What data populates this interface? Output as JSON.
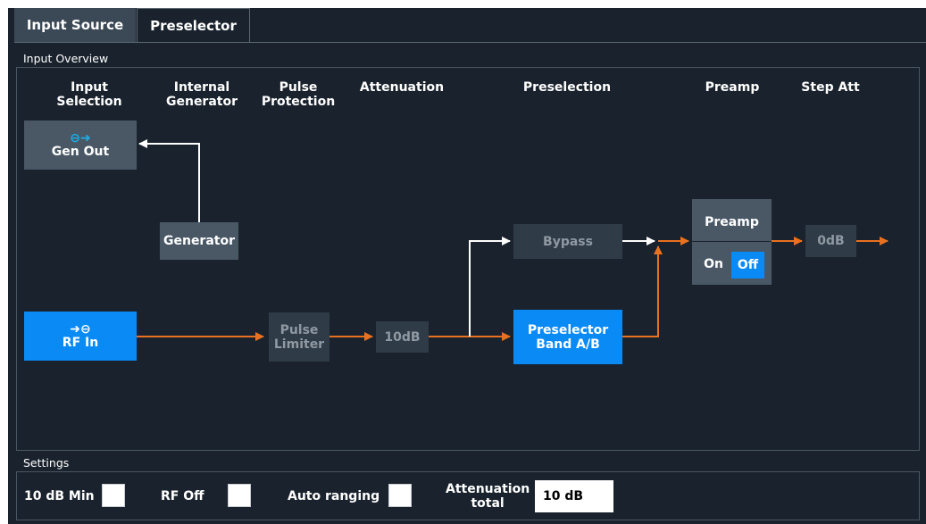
{
  "tabs": [
    {
      "label": "Input Source",
      "active": false
    },
    {
      "label": "Preselector",
      "active": true
    }
  ],
  "overview": {
    "group_label": "Input Overview",
    "headers": {
      "input_selection_1": "Input",
      "input_selection_2": "Selection",
      "internal_generator_1": "Internal",
      "internal_generator_2": "Generator",
      "pulse_protection_1": "Pulse",
      "pulse_protection_2": "Protection",
      "attenuation": "Attenuation",
      "preselection": "Preselection",
      "preamp": "Preamp",
      "step_att": "Step Att"
    },
    "blocks": {
      "gen_out": "Gen Out",
      "generator": "Generator",
      "rf_in": "RF In",
      "pulse_limiter_1": "Pulse",
      "pulse_limiter_2": "Limiter",
      "attenuation_value": "10dB",
      "bypass": "Bypass",
      "preselector_band_1": "Preselector",
      "preselector_band_2": "Band A/B",
      "preamp_title": "Preamp",
      "preamp_on": "On",
      "preamp_off": "Off",
      "step_att_value": "0dB"
    },
    "icons": {
      "gen_out": "output-arrow-icon",
      "rf_in": "input-arrow-icon"
    },
    "colors": {
      "signal_path": "#e8711f",
      "inactive_path": "#ffffff",
      "active_block": "#0a8af5"
    }
  },
  "settings": {
    "group_label": "Settings",
    "min_10db_label": "10 dB Min",
    "min_10db_checked": false,
    "rf_off_label": "RF Off",
    "rf_off_checked": false,
    "auto_ranging_label": "Auto ranging",
    "auto_ranging_checked": false,
    "attenuation_total_label_1": "Attenuation",
    "attenuation_total_label_2": "total",
    "attenuation_total_value": "10 dB"
  }
}
